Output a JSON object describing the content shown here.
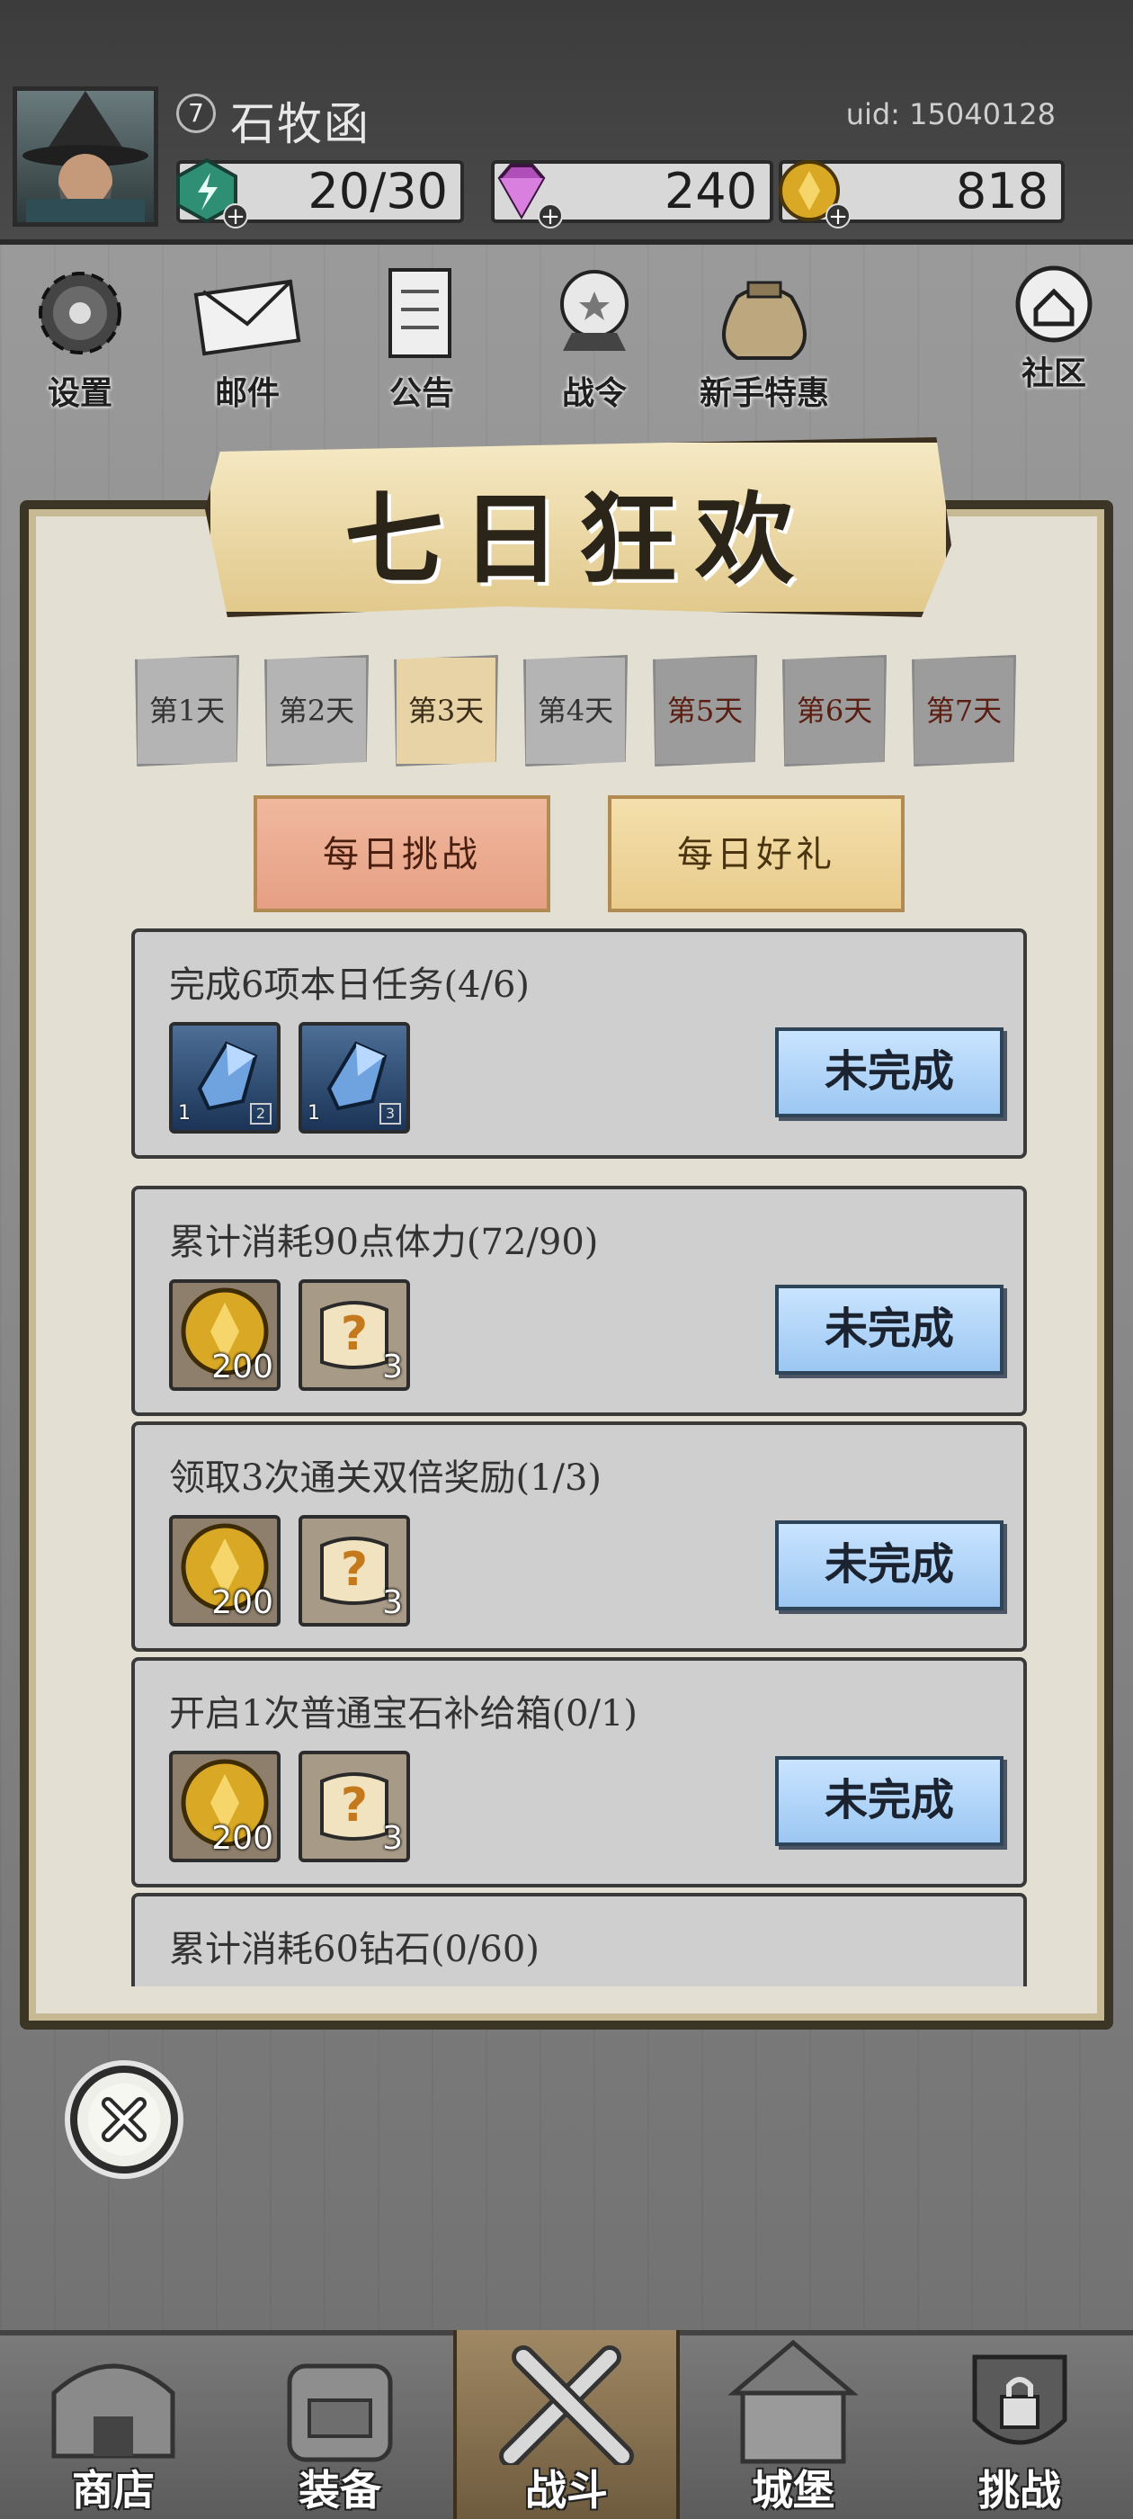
{
  "player": {
    "name": "石牧函",
    "level": "7",
    "uid": "uid: 15040128"
  },
  "resources": {
    "stamina": "20/30",
    "diamonds": "240",
    "gold": "818"
  },
  "top_menu": [
    {
      "label": "设置",
      "icon": "gear-icon"
    },
    {
      "label": "邮件",
      "icon": "mail-icon"
    },
    {
      "label": "公告",
      "icon": "scroll-icon"
    },
    {
      "label": "战令",
      "icon": "crystal-ball-icon"
    },
    {
      "label": "新手特惠",
      "icon": "money-bag-icon"
    },
    {
      "label": "社区",
      "icon": "home-bubble-icon"
    }
  ],
  "event": {
    "title": "七日狂欢",
    "days": [
      "第1天",
      "第2天",
      "第3天",
      "第4天",
      "第5天",
      "第6天",
      "第7天"
    ],
    "selected_day": "第3天",
    "tabs": {
      "challenge": "每日挑战",
      "gift": "每日好礼"
    },
    "tasks": [
      {
        "title": "完成6项本日任务(4/6)",
        "rewards": [
          {
            "type": "blue-crystal",
            "qty": "1",
            "tier": "2"
          },
          {
            "type": "blue-crystal",
            "qty": "1",
            "tier": "3"
          }
        ],
        "button": "未完成"
      },
      {
        "title": "累计消耗90点体力(72/90)",
        "rewards": [
          {
            "type": "gold-coin",
            "qty": "200"
          },
          {
            "type": "mystery-scroll",
            "qty": "3"
          }
        ],
        "button": "未完成"
      },
      {
        "title": "领取3次通关双倍奖励(1/3)",
        "rewards": [
          {
            "type": "gold-coin",
            "qty": "200"
          },
          {
            "type": "mystery-scroll",
            "qty": "3"
          }
        ],
        "button": "未完成"
      },
      {
        "title": "开启1次普通宝石补给箱(0/1)",
        "rewards": [
          {
            "type": "gold-coin",
            "qty": "200"
          },
          {
            "type": "mystery-scroll",
            "qty": "3"
          }
        ],
        "button": "未完成"
      },
      {
        "title": "累计消耗60钻石(0/60)"
      }
    ]
  },
  "bottom_nav": [
    {
      "label": "商店",
      "icon": "shop-icon"
    },
    {
      "label": "装备",
      "icon": "backpack-icon"
    },
    {
      "label": "战斗",
      "icon": "crossed-swords-icon",
      "active": true
    },
    {
      "label": "城堡",
      "icon": "castle-icon"
    },
    {
      "label": "挑战",
      "icon": "locked-shield-icon"
    }
  ],
  "colors": {
    "accent_button": "#9cc7f2",
    "tab_active": "#e69f84",
    "tab_inactive": "#e9cc8c",
    "day_selected": "#e7d3a5"
  }
}
